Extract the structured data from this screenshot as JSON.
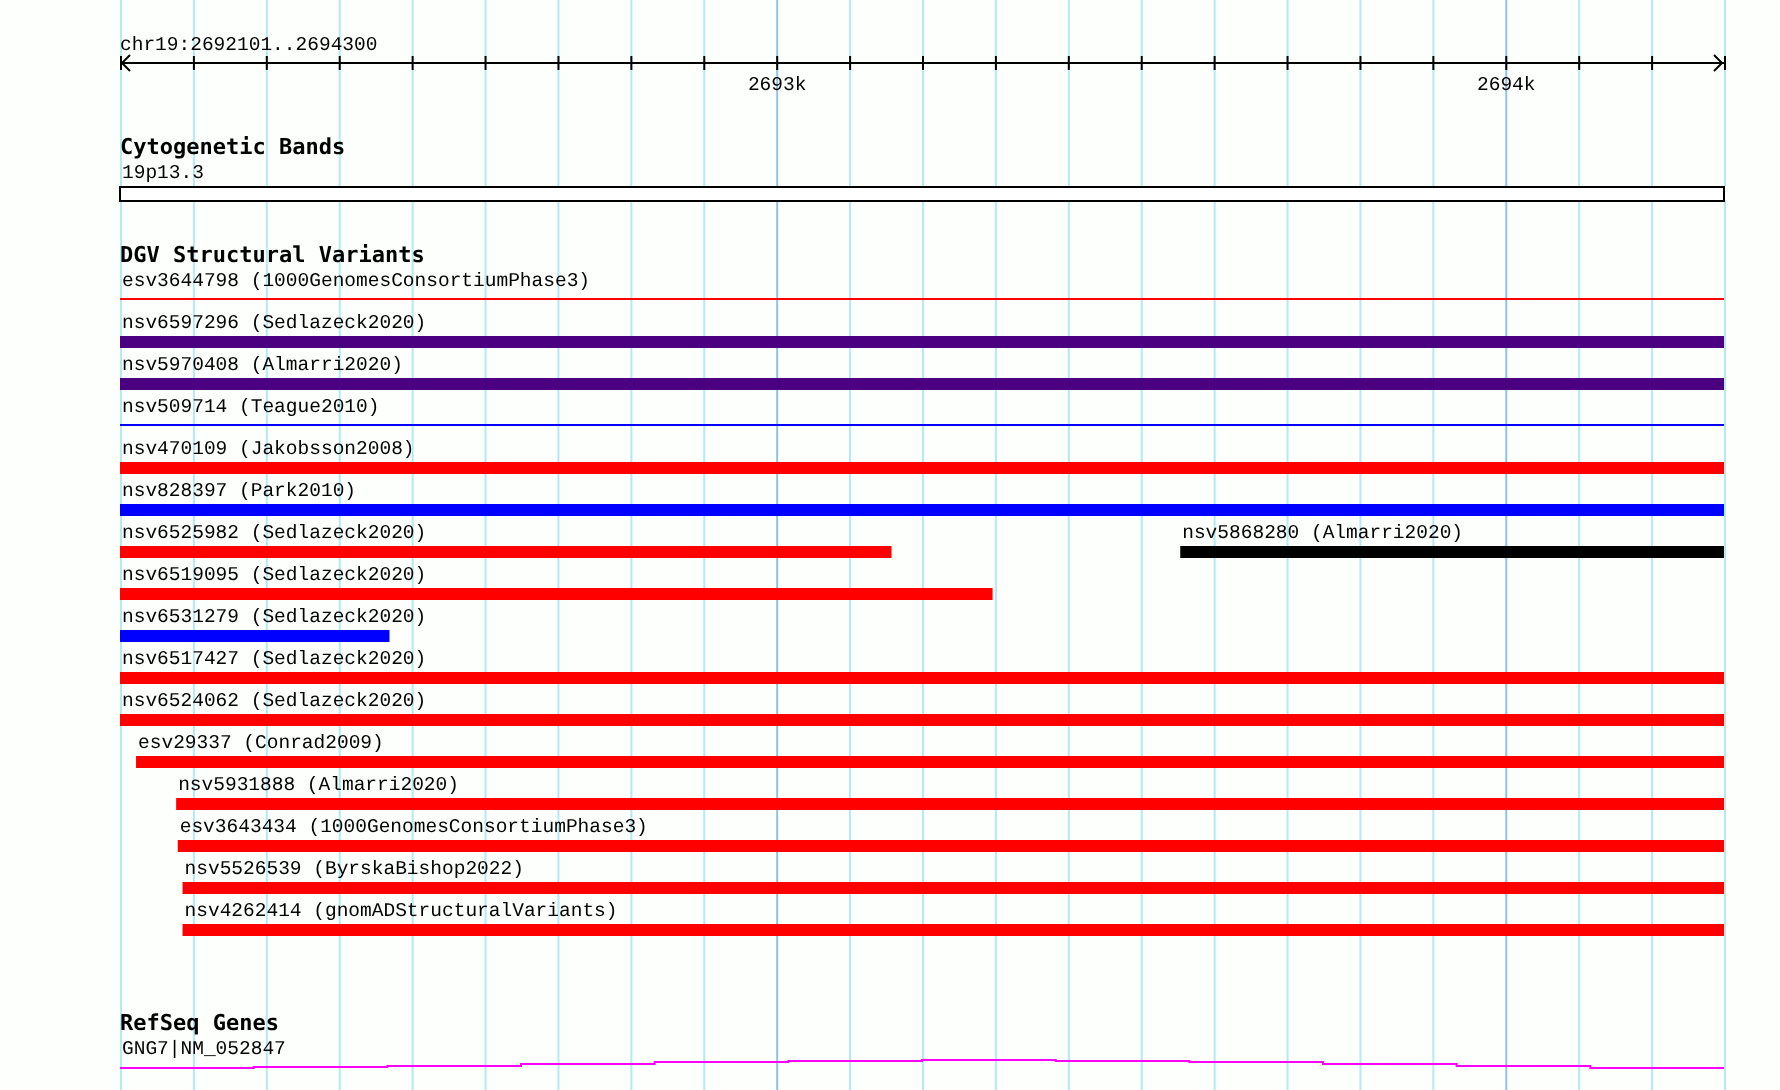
{
  "ruler": {
    "location": "chr19:2692101..2694300",
    "tick_labels": [
      "2693k",
      "2694k"
    ]
  },
  "cytogenetic_bands": {
    "title": "Cytogenetic Bands",
    "band": "19p13.3"
  },
  "dgv": {
    "title": "DGV Structural Variants",
    "lanes": [
      {
        "features": [
          {
            "label": "esv3644798 (1000GenomesConsortiumPhase3)",
            "kind": "line",
            "level": 1,
            "color": "#ff0000"
          }
        ]
      },
      {
        "features": [
          {
            "label": "nsv6597296 (Sedlazeck2020)",
            "kind": "bar",
            "level": 1,
            "color": "#4b0082"
          }
        ]
      },
      {
        "features": [
          {
            "label": "nsv5970408 (Almarri2020)",
            "kind": "bar",
            "level": 1,
            "color": "#4b0082"
          }
        ]
      },
      {
        "features": [
          {
            "label": "nsv509714 (Teague2010)",
            "kind": "line",
            "level": 1,
            "color": "#0000ff"
          }
        ]
      },
      {
        "features": [
          {
            "label": "nsv470109 (Jakobsson2008)",
            "kind": "bar",
            "level": 1,
            "color": "#ff0000"
          }
        ]
      },
      {
        "features": [
          {
            "label": "nsv828397 (Park2010)",
            "kind": "bar",
            "level": 1,
            "color": "#0000ff"
          }
        ]
      },
      {
        "features": [
          {
            "label": "nsv6525982 (Sedlazeck2020)",
            "kind": "bar",
            "level": 0.481,
            "color": "#ff0000"
          },
          {
            "label": "nsv5868280 (Almarri2020)",
            "kind": "endbar",
            "level": 0.339,
            "color": "#000000"
          }
        ]
      },
      {
        "features": [
          {
            "label": "nsv6519095 (Sedlazeck2020)",
            "kind": "bar",
            "level": 0.544,
            "color": "#ff0000"
          }
        ]
      },
      {
        "features": [
          {
            "label": "nsv6531279 (Sedlazeck2020)",
            "kind": "bar",
            "level": 0.168,
            "color": "#0000ff"
          }
        ]
      },
      {
        "features": [
          {
            "label": "nsv6517427 (Sedlazeck2020)",
            "kind": "bar",
            "level": 1,
            "color": "#ff0000"
          }
        ]
      },
      {
        "features": [
          {
            "label": "nsv6524062 (Sedlazeck2020)",
            "kind": "bar",
            "level": 1,
            "color": "#ff0000"
          }
        ]
      },
      {
        "features": [
          {
            "label": "esv29337 (Conrad2009)",
            "kind": "endbar",
            "level": 0.99,
            "color": "#ff0000"
          }
        ]
      },
      {
        "features": [
          {
            "label": "nsv5931888 (Almarri2020)",
            "kind": "endbar",
            "level": 0.965,
            "color": "#ff0000"
          }
        ]
      },
      {
        "features": [
          {
            "label": "esv3643434 (1000GenomesConsortiumPhase3)",
            "kind": "endbar",
            "level": 0.964,
            "color": "#ff0000"
          }
        ]
      },
      {
        "features": [
          {
            "label": "nsv5526539 (ByrskaBishop2022)",
            "kind": "endbar",
            "level": 0.961,
            "color": "#ff0000"
          }
        ]
      },
      {
        "features": [
          {
            "label": "nsv4262414 (gnomADStructuralVariants)",
            "kind": "endbar",
            "level": 0.961,
            "color": "#ff0000"
          }
        ]
      }
    ]
  },
  "refseq_genes": {
    "title": "RefSeq Genes",
    "gene": "GNG7|NM_052847"
  }
}
